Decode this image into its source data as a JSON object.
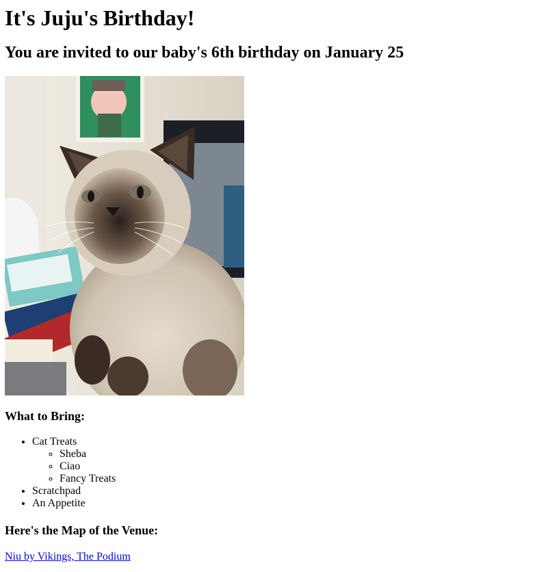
{
  "page": {
    "title": "It's Juju's Birthday!",
    "subtitle": "You are invited to our baby's 6th birthday on January 25"
  },
  "photo": {
    "subject": "cat-photo",
    "colors": {
      "wall": "#d9d4c7",
      "fur_light": "#d8cdbd",
      "fur_dark": "#3a2c24",
      "poster_green": "#2f8f5f",
      "books_red": "#b3282a",
      "monitor": "#1c1f26"
    }
  },
  "bring": {
    "heading": "What to Bring:",
    "items": [
      {
        "label": "Cat Treats",
        "sub": [
          "Sheba",
          "Ciao",
          "Fancy Treats"
        ]
      },
      {
        "label": "Scratchpad"
      },
      {
        "label": "An Appetite"
      }
    ]
  },
  "venue": {
    "heading": "Here's the Map of the Venue:",
    "link_text": "Niu by Vikings, The Podium",
    "link_color": "#0000EE"
  }
}
